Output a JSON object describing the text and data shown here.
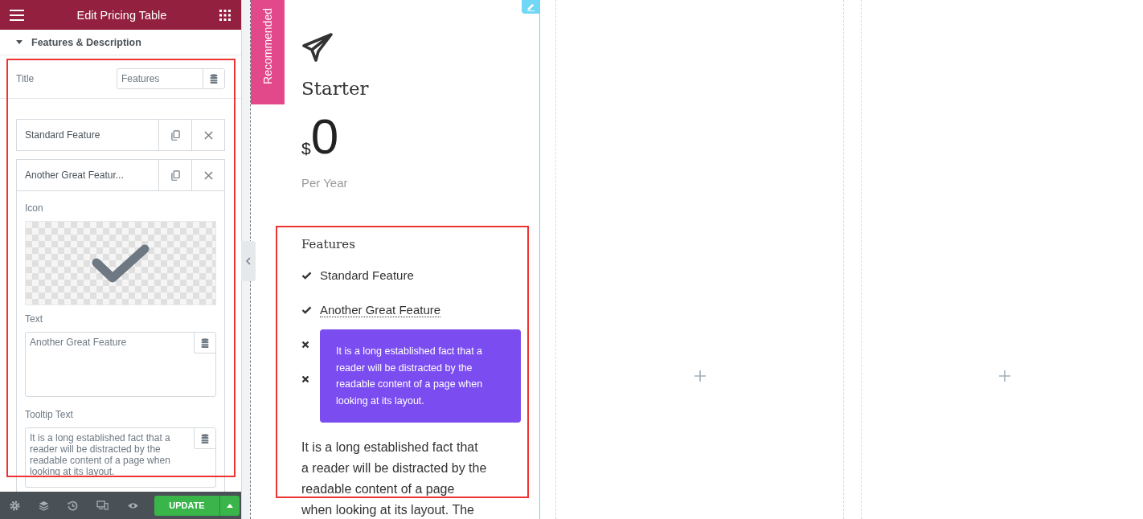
{
  "panel": {
    "title": "Edit Pricing Table",
    "section": {
      "label": "Features & Description",
      "expanded": true
    },
    "title_field": {
      "label": "Title",
      "value": "Features"
    },
    "items": [
      {
        "label": "Standard Feature",
        "expanded": false
      },
      {
        "label": "Another Great Featur...",
        "expanded": true
      }
    ],
    "item_editor": {
      "icon_label": "Icon",
      "text_label": "Text",
      "text_value": "Another Great Feature",
      "tooltip_label": "Tooltip Text",
      "tooltip_value": "It is a long established fact that a reader will be distracted by the readable content of a page when looking at its layout."
    },
    "update_button": "UPDATE"
  },
  "pricing": {
    "ribbon": "Recommended",
    "heading": "Starter",
    "currency": "$",
    "price": "0",
    "period": "Per Year",
    "features_title": "Features",
    "features": [
      {
        "text": "Standard Feature",
        "included": true,
        "tooltip": false
      },
      {
        "text": "Another Great Feature",
        "included": true,
        "tooltip": true
      },
      {
        "included": false
      },
      {
        "included": false
      }
    ],
    "tooltip": "It is a long established fact that a reader will be distracted by the readable content of a page when looking at its layout.",
    "description": "It is a long established fact that a reader will be distracted by the readable content of a page when looking at its layout. The"
  }
}
